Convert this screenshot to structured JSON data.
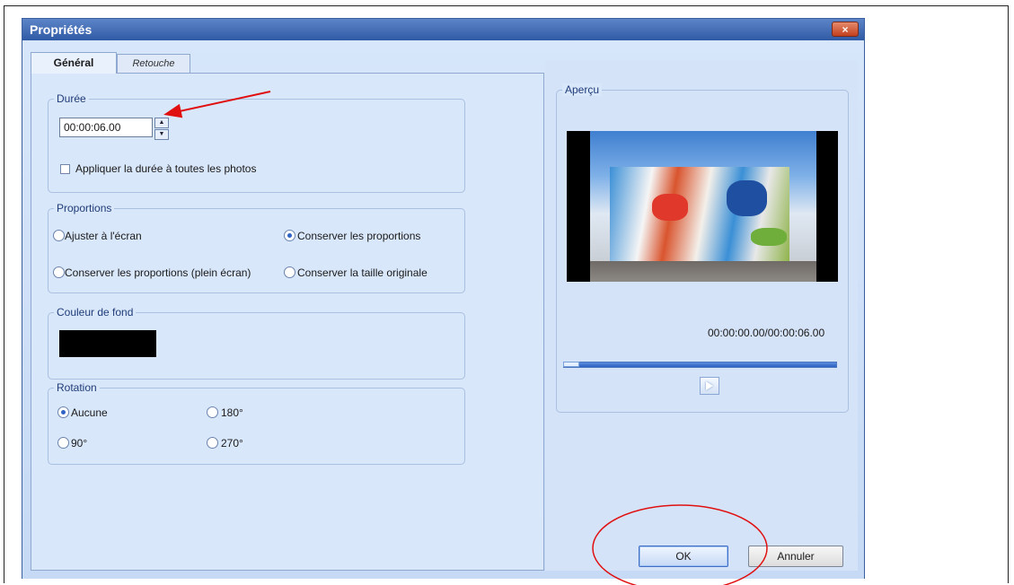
{
  "window": {
    "title": "Propriétés",
    "close_glyph": "×"
  },
  "tabs": [
    {
      "label": "Général",
      "active": true
    },
    {
      "label": "Retouche",
      "active": false
    }
  ],
  "duration": {
    "legend": "Durée",
    "value": "00:00:06.00",
    "apply_all_label": "Appliquer la durée à toutes les photos",
    "apply_all_checked": false
  },
  "proportions": {
    "legend": "Proportions",
    "options": [
      {
        "label": "Ajuster à l'écran",
        "checked": false
      },
      {
        "label": "Conserver les proportions",
        "checked": true
      },
      {
        "label": "Conserver les proportions (plein écran)",
        "checked": false
      },
      {
        "label": "Conserver la taille originale",
        "checked": false
      }
    ]
  },
  "background": {
    "legend": "Couleur de fond",
    "color": "#000000"
  },
  "rotation": {
    "legend": "Rotation",
    "options": [
      {
        "label": "Aucune",
        "checked": true
      },
      {
        "label": "180°",
        "checked": false
      },
      {
        "label": "90°",
        "checked": false
      },
      {
        "label": "270°",
        "checked": false
      }
    ]
  },
  "preview": {
    "legend": "Aperçu",
    "timecode": "00:00:00.00/00:00:06.00",
    "progress": 0.0,
    "play_icon": "play-icon"
  },
  "buttons": {
    "ok_label": "OK",
    "cancel_label": "Annuler"
  },
  "colors": {
    "title_bar": "#2f5aa5",
    "annotation": "#e01010",
    "radio_selected": "#2f64c6"
  }
}
